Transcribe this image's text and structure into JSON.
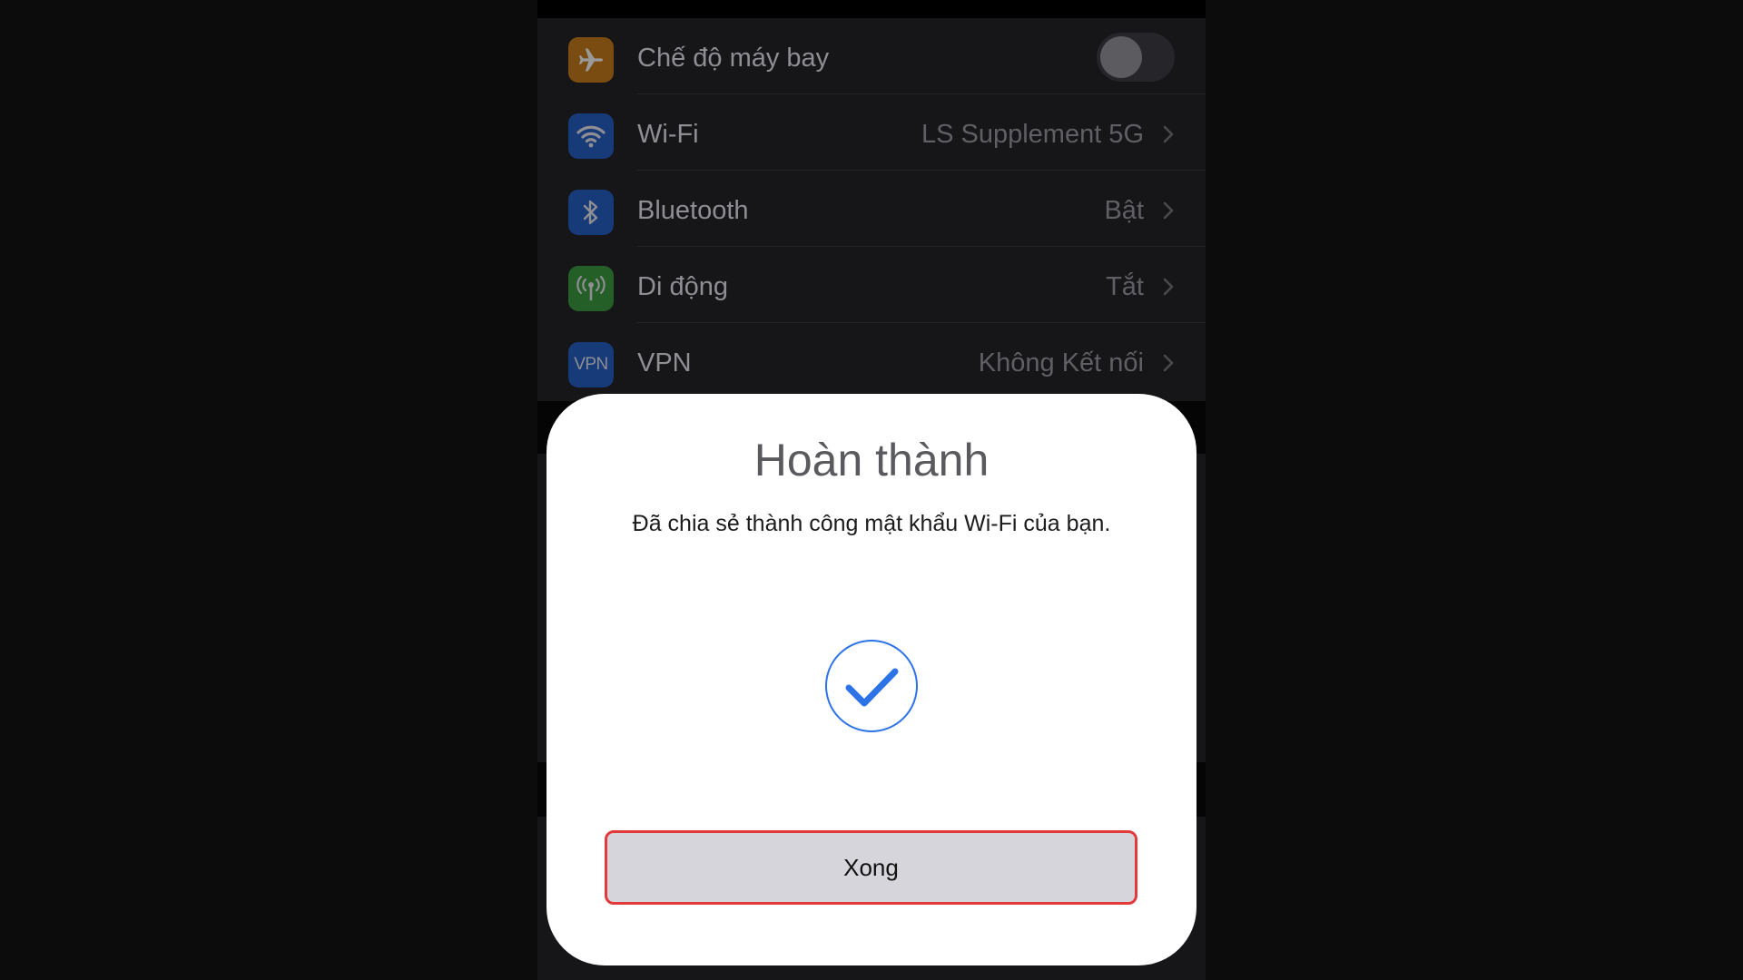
{
  "settings": {
    "rows": [
      {
        "label": "Chế độ máy bay",
        "icon": "airplane-icon",
        "icon_color": "#e08a1e",
        "toggle": "off"
      },
      {
        "label": "Wi-Fi",
        "value": "LS Supplement 5G",
        "icon": "wifi-icon",
        "icon_color": "#1f63d8"
      },
      {
        "label": "Bluetooth",
        "value": "Bật",
        "icon": "bluetooth-icon",
        "icon_color": "#1f63d8"
      },
      {
        "label": "Di động",
        "value": "Tắt",
        "icon": "cellular-icon",
        "icon_color": "#3a9b3e"
      },
      {
        "label": "VPN",
        "value": "Không Kết nối",
        "icon": "vpn-icon",
        "icon_text": "VPN",
        "icon_color": "#1f63d8"
      }
    ]
  },
  "modal": {
    "title": "Hoàn thành",
    "message": "Đã chia sẻ thành công mật khẩu Wi-Fi của bạn.",
    "status_icon": "checkmark-circle-icon",
    "done_label": "Xong"
  },
  "colors": {
    "accent_blue": "#2d73e8",
    "highlight_border": "#e23a3a",
    "button_bg": "#d6d5db"
  }
}
